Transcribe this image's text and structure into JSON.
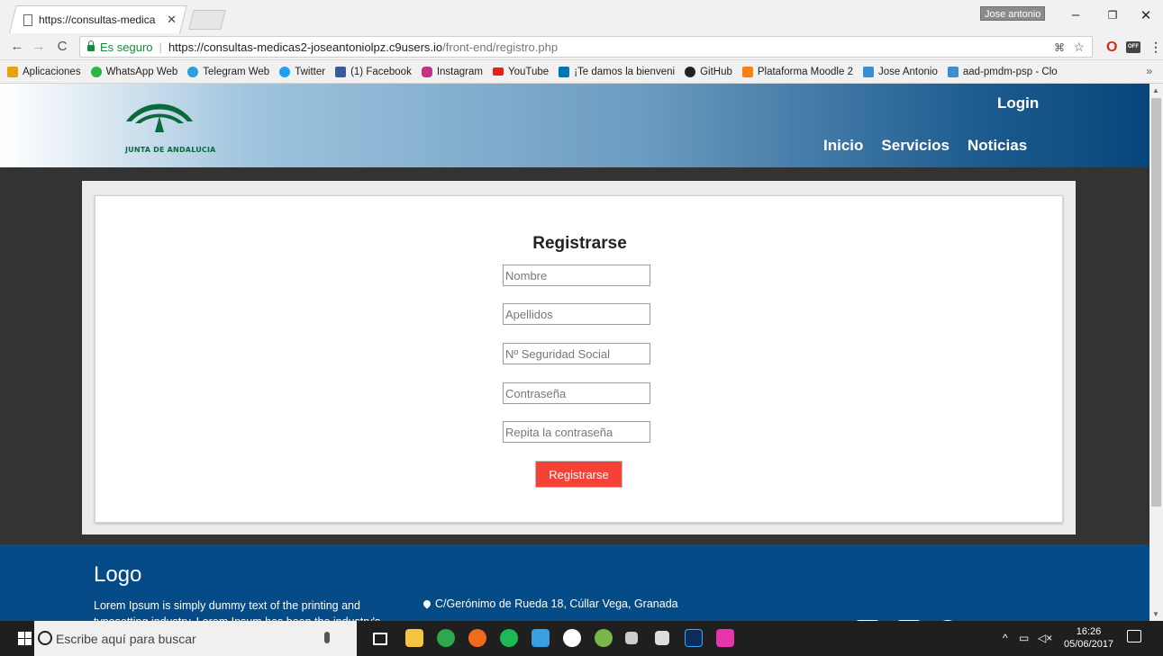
{
  "browser": {
    "tab_title": "https://consultas-medica",
    "user_name": "Jose antonio",
    "security_label": "Es seguro",
    "url_host": "https://consultas-medicas2-joseantoniolpz.c9users.io",
    "url_path": "/front-end/registro.php",
    "bookmarks": [
      {
        "label": "Aplicaciones",
        "icon": "apps-grid-icon",
        "color": "#e8a20b"
      },
      {
        "label": "WhatsApp Web",
        "icon": "whatsapp-icon",
        "color": "#2bb741"
      },
      {
        "label": "Telegram Web",
        "icon": "telegram-icon",
        "color": "#2a9fd8"
      },
      {
        "label": "Twitter",
        "icon": "twitter-icon",
        "color": "#1da1f2"
      },
      {
        "label": "(1) Facebook",
        "icon": "facebook-icon",
        "color": "#3b5998"
      },
      {
        "label": "Instagram",
        "icon": "instagram-icon",
        "color": "#c13584"
      },
      {
        "label": "YouTube",
        "icon": "youtube-icon",
        "color": "#e62117"
      },
      {
        "label": "¡Te damos la bienveni",
        "icon": "linkedin-icon",
        "color": "#0077b5"
      },
      {
        "label": "GitHub",
        "icon": "github-icon",
        "color": "#222222"
      },
      {
        "label": "Plataforma Moodle 2",
        "icon": "moodle-icon",
        "color": "#f98012"
      },
      {
        "label": "Jose Antonio",
        "icon": "cloud9-icon",
        "color": "#3d8ed0"
      },
      {
        "label": "aad-pmdm-psp - Clo",
        "icon": "cloud9-icon",
        "color": "#3d8ed0"
      }
    ]
  },
  "site": {
    "logo_text": "JUNTA DE ANDALUCIA",
    "nav_login": "Login",
    "nav": [
      "Inicio",
      "Servicios",
      "Noticias"
    ]
  },
  "form": {
    "title": "Registrarse",
    "fields": [
      {
        "placeholder": "Nombre",
        "value": ""
      },
      {
        "placeholder": "Apellidos",
        "value": ""
      },
      {
        "placeholder": "Nº Seguridad Social",
        "value": ""
      },
      {
        "placeholder": "Contraseña",
        "value": ""
      },
      {
        "placeholder": "Repita la contraseña",
        "value": ""
      }
    ],
    "submit_label": "Registrarse"
  },
  "footer": {
    "logo": "Logo",
    "text": "Lorem Ipsum is simply dummy text of the printing and typesetting industry. Lorem Ipsum has been the industry's",
    "address": "C/Gerónimo de Rueda 18, Cúllar Vega, Granada"
  },
  "taskbar": {
    "search_placeholder": "Escribe aquí para buscar",
    "time": "16:26",
    "date": "05/06/2017"
  },
  "colors": {
    "accent_button": "#f44336",
    "footer_bg": "#054b87",
    "secure_green": "#1a8a3a"
  }
}
